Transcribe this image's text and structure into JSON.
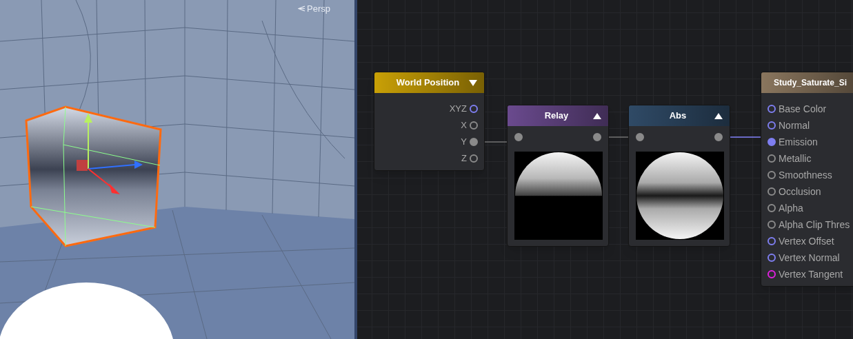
{
  "viewport": {
    "camera_label": "Persp"
  },
  "graph": {
    "nodes": [
      {
        "kind": "input",
        "title": "World Position",
        "color": "#c9a006",
        "preview_expanded": false,
        "ports": [
          {
            "label": "XYZ",
            "color": "#7e7ef0",
            "connected": false
          },
          {
            "label": "X",
            "color": "#8a8a8a",
            "connected": false
          },
          {
            "label": "Y",
            "color": "#8a8a8a",
            "connected": true
          },
          {
            "label": "Z",
            "color": "#8a8a8a",
            "connected": false
          }
        ]
      },
      {
        "kind": "relay",
        "title": "Relay",
        "color": "#6a4a8e",
        "preview_expanded": true,
        "ports": [
          {
            "color": "#8a8a8a",
            "connected": true
          },
          {
            "color": "#8a8a8a",
            "connected": true
          }
        ]
      },
      {
        "kind": "abs",
        "title": "Abs",
        "color": "#2f4a66",
        "preview_expanded": true,
        "ports": [
          {
            "color": "#8a8a8a",
            "connected": true
          },
          {
            "color": "#8a8a8a",
            "connected": true
          }
        ]
      },
      {
        "kind": "master",
        "title": "Study_Saturate_Si",
        "color": "#8a765e",
        "ports": [
          {
            "label": "Base Color",
            "color": "#7e7ef0",
            "connected": false
          },
          {
            "label": "Normal",
            "color": "#7e7ef0",
            "connected": false
          },
          {
            "label": "Emission",
            "color": "#7e7ef0",
            "connected": true
          },
          {
            "label": "Metallic",
            "color": "#8a8a8a",
            "connected": false
          },
          {
            "label": "Smoothness",
            "color": "#8a8a8a",
            "connected": false
          },
          {
            "label": "Occlusion",
            "color": "#8a8a8a",
            "connected": false
          },
          {
            "label": "Alpha",
            "color": "#8a8a8a",
            "connected": false
          },
          {
            "label": "Alpha Clip Thres",
            "color": "#8a8a8a",
            "connected": false
          },
          {
            "label": "Vertex Offset",
            "color": "#7e7ef0",
            "connected": false
          },
          {
            "label": "Vertex Normal",
            "color": "#7e7ef0",
            "connected": false
          },
          {
            "label": "Vertex Tangent",
            "color": "#e020e0",
            "connected": false
          }
        ]
      }
    ]
  }
}
